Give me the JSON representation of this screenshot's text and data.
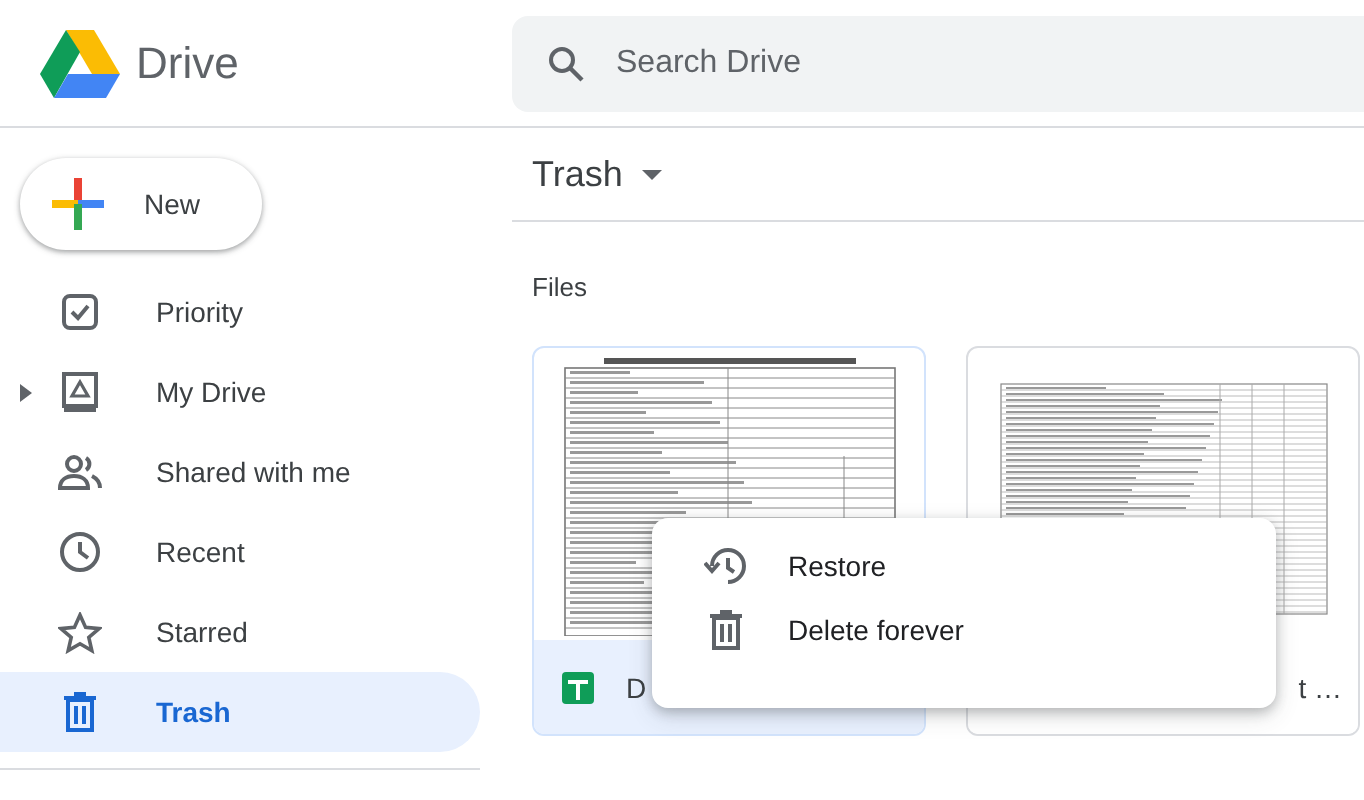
{
  "app": {
    "name": "Drive"
  },
  "search": {
    "placeholder": "Search Drive"
  },
  "new_button": {
    "label": "New"
  },
  "sidebar": {
    "items": [
      {
        "label": "Priority",
        "kind": "priority",
        "selected": false,
        "expandable": false
      },
      {
        "label": "My Drive",
        "kind": "drive",
        "selected": false,
        "expandable": true
      },
      {
        "label": "Shared with me",
        "kind": "shared",
        "selected": false,
        "expandable": false
      },
      {
        "label": "Recent",
        "kind": "recent",
        "selected": false,
        "expandable": false
      },
      {
        "label": "Starred",
        "kind": "starred",
        "selected": false,
        "expandable": false
      },
      {
        "label": "Trash",
        "kind": "trash",
        "selected": true,
        "expandable": false
      }
    ]
  },
  "main": {
    "title": "Trash",
    "section": "Files",
    "files": [
      {
        "name": "D",
        "selected": true,
        "kind": "form"
      },
      {
        "name": "t …",
        "selected": false,
        "kind": "table"
      }
    ]
  },
  "context_menu": {
    "items": [
      {
        "label": "Restore",
        "kind": "restore"
      },
      {
        "label": "Delete forever",
        "kind": "delete"
      }
    ]
  }
}
